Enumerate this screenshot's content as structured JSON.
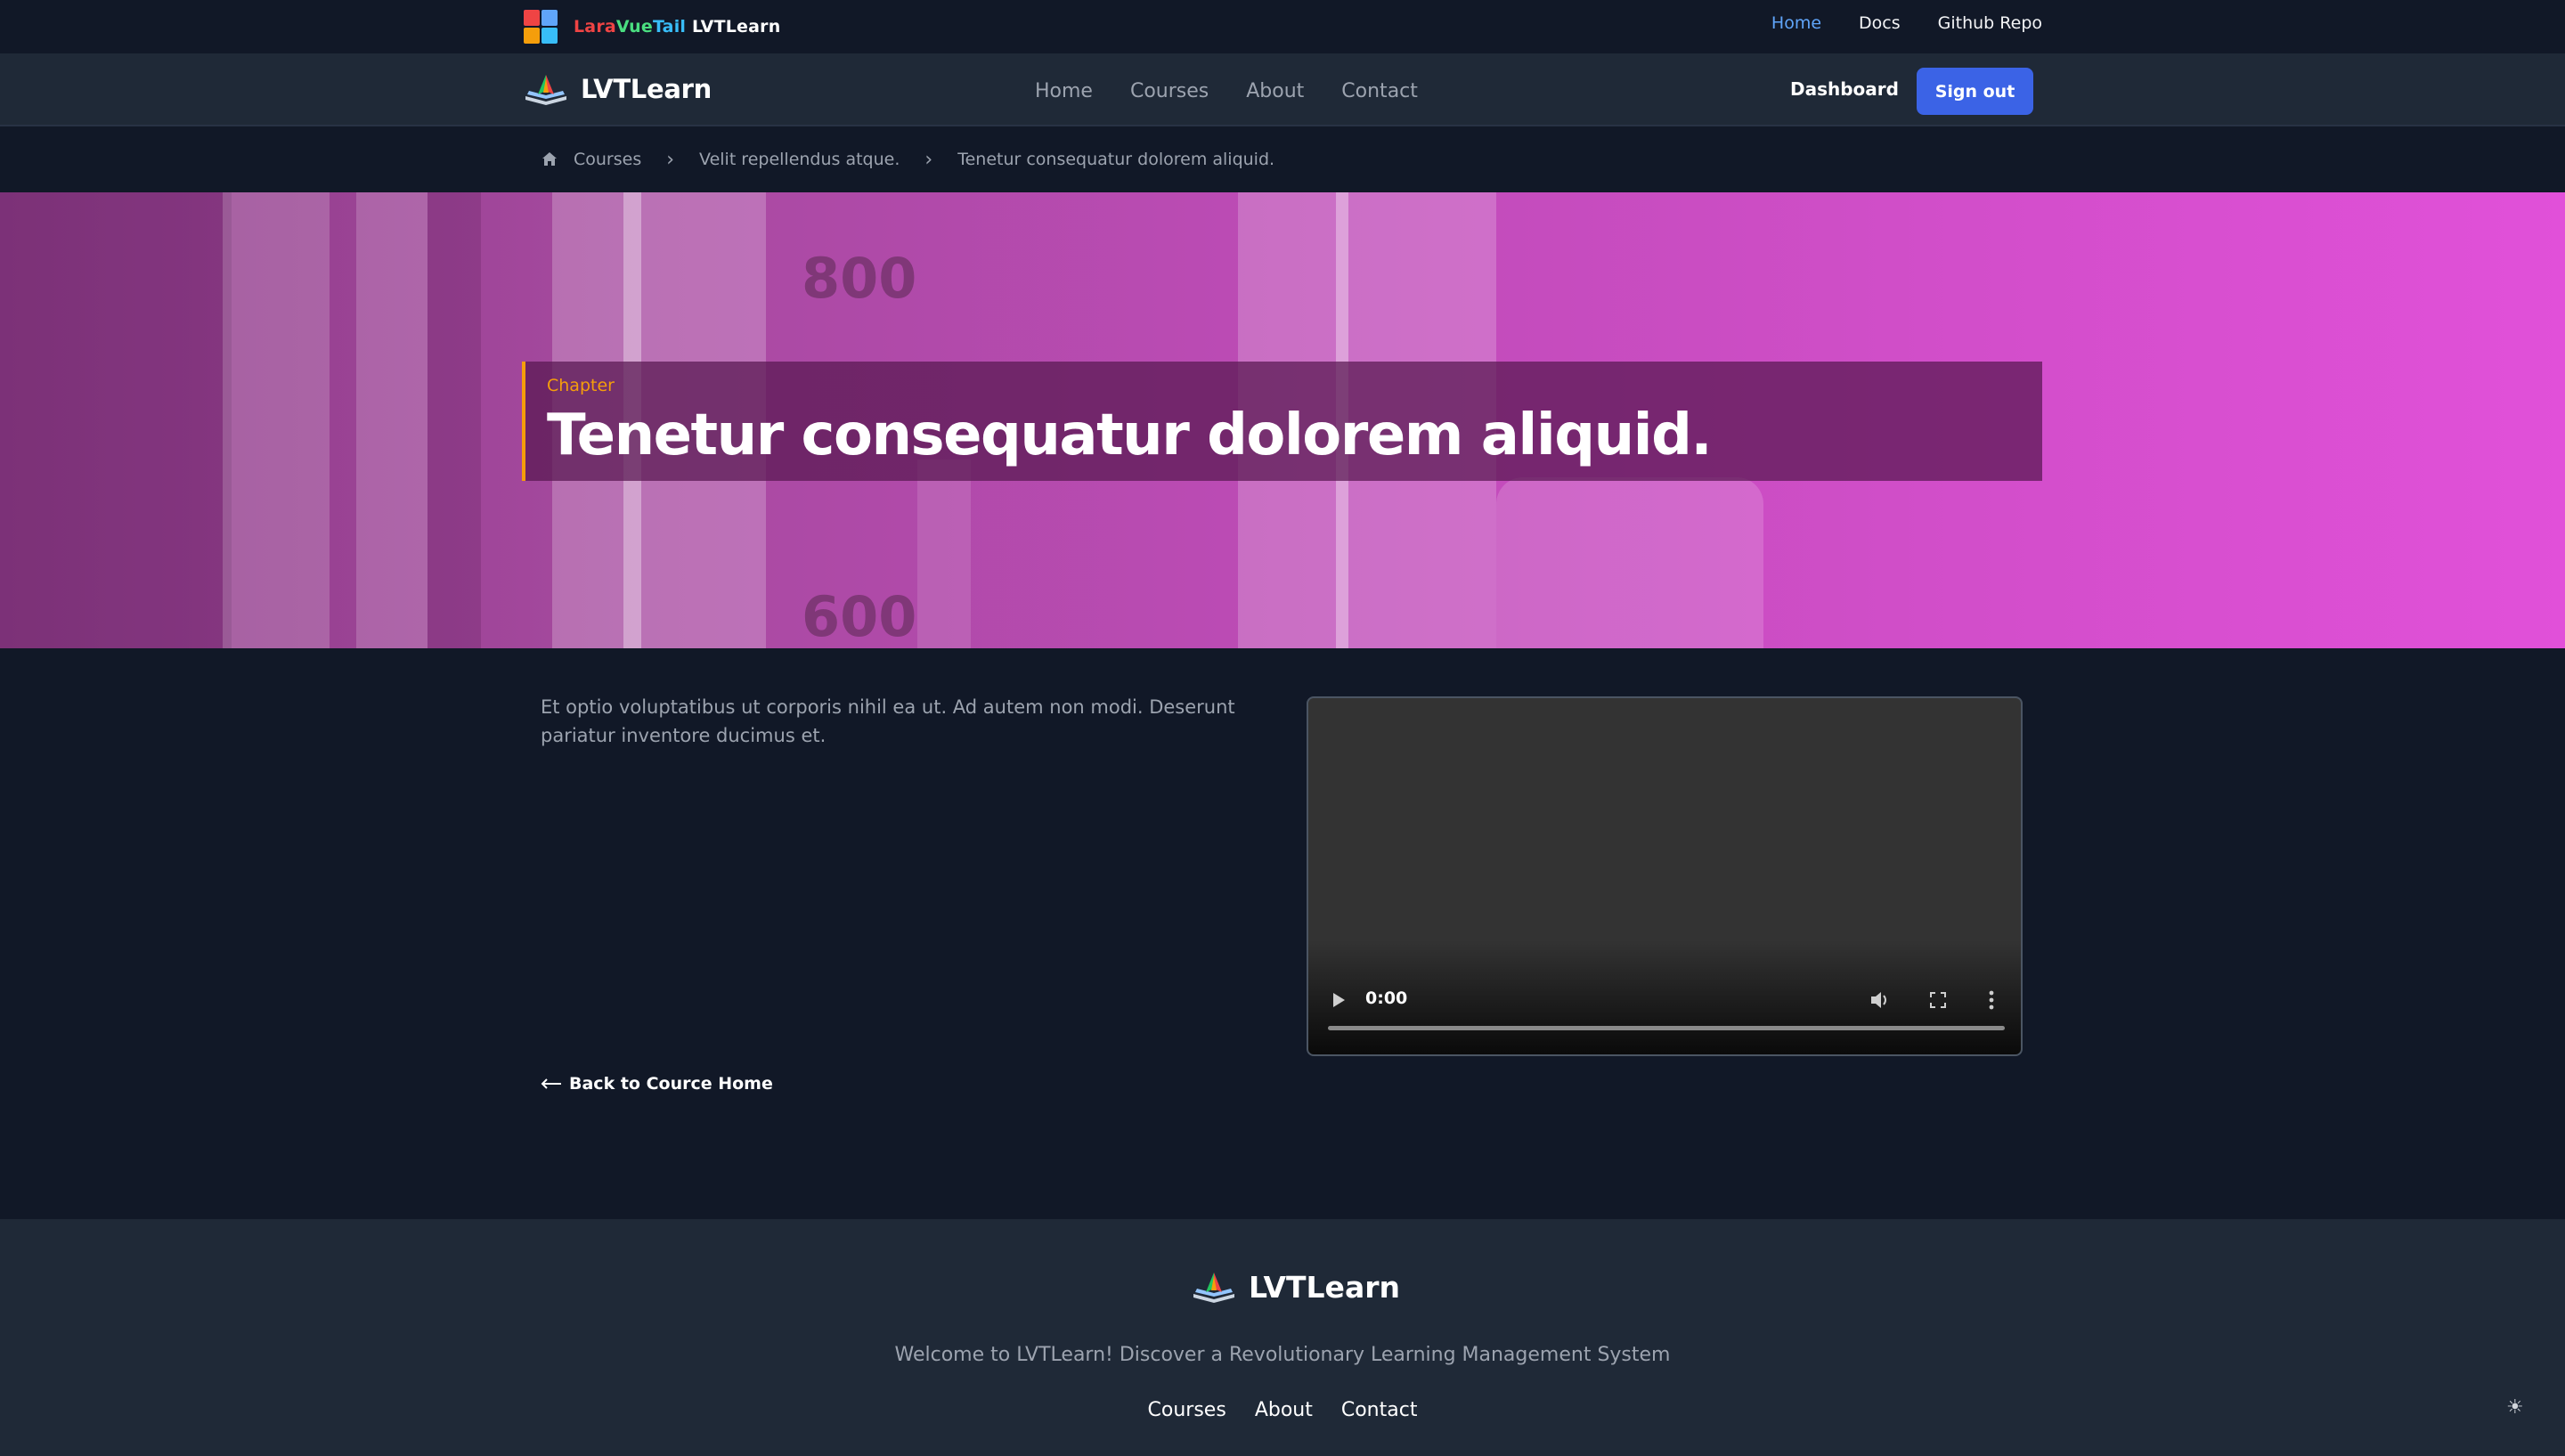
{
  "topbar": {
    "brand": {
      "lara": "Lara",
      "vue": "Vue",
      "tail": "Tail",
      "lvt": "LVTLearn"
    },
    "links": [
      {
        "label": "Home",
        "active": true
      },
      {
        "label": "Docs",
        "active": false
      },
      {
        "label": "Github Repo",
        "active": false
      }
    ]
  },
  "nav": {
    "logo_text": "LVTLearn",
    "links": [
      "Home",
      "Courses",
      "About",
      "Contact"
    ],
    "dashboard": "Dashboard",
    "sign_out": "Sign out"
  },
  "breadcrumb": {
    "items": [
      "Courses",
      "Velit repellendus atque.",
      "Tenetur consequatur dolorem aliquid."
    ]
  },
  "hero": {
    "label": "Chapter",
    "title": "Tenetur consequatur dolorem aliquid."
  },
  "content": {
    "description": "Et optio voluptatibus ut corporis nihil ea ut. Ad autem non modi. Deserunt pariatur inventore ducimus et.",
    "video_time": "0:00",
    "back_link": "Back to Cource Home"
  },
  "footer": {
    "logo_text": "LVTLearn",
    "tagline": "Welcome to LVTLearn! Discover a Revolutionary Learning Management System",
    "links": [
      "Courses",
      "About",
      "Contact"
    ]
  },
  "colors": {
    "accent": "#3b63e6",
    "chapter_accent": "#f59e0b",
    "active_link": "#60a5fa"
  },
  "icons": [
    "lvt-logo-icon",
    "book-logo-icon",
    "home-icon",
    "chevron-right-icon",
    "play-icon",
    "volume-icon",
    "fullscreen-icon",
    "more-vert-icon",
    "arrow-left-icon",
    "sun-icon"
  ]
}
